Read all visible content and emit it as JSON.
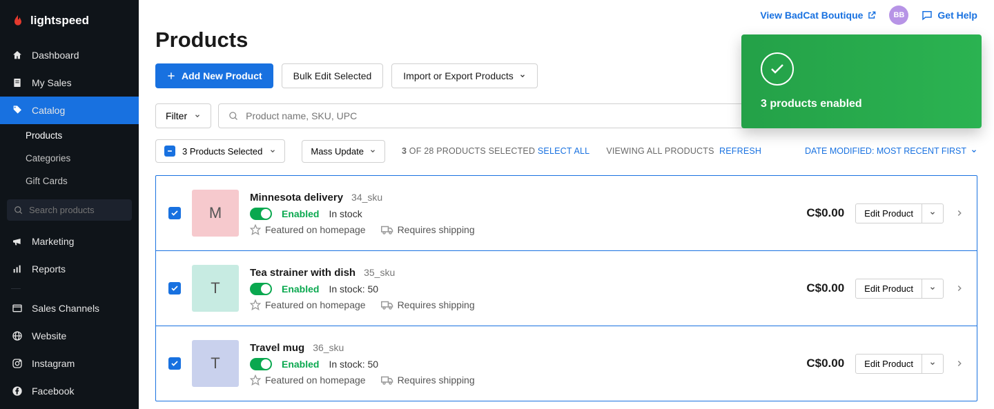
{
  "brand": "lightspeed",
  "topbar": {
    "view_link": "View BadCat Boutique",
    "avatar": "BB",
    "help": "Get Help"
  },
  "sidebar": {
    "items": [
      {
        "label": "Dashboard"
      },
      {
        "label": "My Sales"
      },
      {
        "label": "Catalog",
        "active": true
      },
      {
        "label": "Marketing"
      },
      {
        "label": "Reports"
      },
      {
        "label": "Sales Channels"
      },
      {
        "label": "Website"
      },
      {
        "label": "Instagram"
      },
      {
        "label": "Facebook"
      }
    ],
    "catalog_sub": [
      {
        "label": "Products",
        "active": true
      },
      {
        "label": "Categories"
      },
      {
        "label": "Gift Cards"
      }
    ],
    "search_placeholder": "Search products"
  },
  "page": {
    "title": "Products",
    "add_btn": "Add New Product",
    "bulk_btn": "Bulk Edit Selected",
    "import_btn": "Import or Export Products",
    "filter_btn": "Filter",
    "search_placeholder": "Product name, SKU, UPC",
    "selected_btn": "3 Products Selected",
    "mass_btn": "Mass Update",
    "status_prefix": "3",
    "status_mid": " OF 28 PRODUCTS SELECTED ",
    "select_all": "SELECT ALL",
    "viewing": "VIEWING ALL PRODUCTS",
    "refresh": "REFRESH",
    "sort": "DATE MODIFIED: MOST RECENT FIRST"
  },
  "toast": {
    "text": "3 products enabled"
  },
  "common": {
    "enabled": "Enabled",
    "featured": "Featured on homepage",
    "shipping": "Requires shipping",
    "edit": "Edit Product"
  },
  "products": [
    {
      "letter": "M",
      "color": "#f6c9cd",
      "name": "Minnesota delivery",
      "sku": "34_sku",
      "stock": "In stock",
      "price": "C$0.00"
    },
    {
      "letter": "T",
      "color": "#c7ebe2",
      "name": "Tea strainer with dish",
      "sku": "35_sku",
      "stock": "In stock: 50",
      "price": "C$0.00"
    },
    {
      "letter": "T",
      "color": "#c9d1ed",
      "name": "Travel mug",
      "sku": "36_sku",
      "stock": "In stock: 50",
      "price": "C$0.00"
    }
  ]
}
